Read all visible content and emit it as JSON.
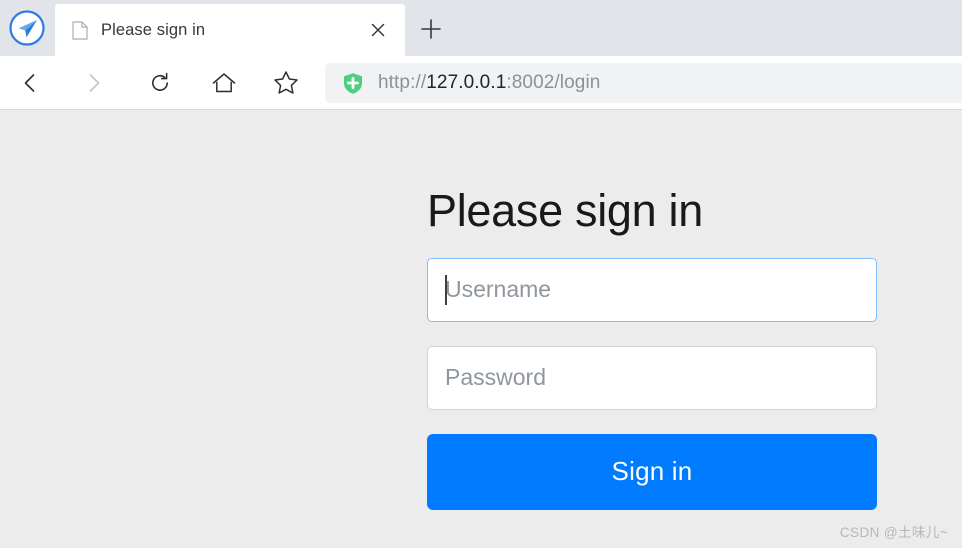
{
  "browser": {
    "logo_icon": "paper-plane-logo-icon",
    "tab": {
      "favicon": "document-page-icon",
      "title": "Please sign in",
      "close_icon": "close-icon"
    },
    "new_tab_icon": "plus-icon",
    "nav": {
      "back_icon": "chevron-left-icon",
      "forward_icon": "chevron-right-icon",
      "reload_icon": "reload-icon",
      "home_icon": "home-icon",
      "bookmark_icon": "star-icon"
    },
    "address_bar": {
      "security_icon": "green-shield-plus-icon",
      "scheme": "http://",
      "host": "127.0.0.1",
      "rest": ":8002/login"
    }
  },
  "page": {
    "heading": "Please sign in",
    "username": {
      "placeholder": "Username",
      "value": "",
      "focused": true
    },
    "password": {
      "placeholder": "Password",
      "value": "",
      "focused": false
    },
    "submit_label": "Sign in",
    "watermark": "CSDN @土味儿~"
  },
  "colors": {
    "accent": "#007bff",
    "focus_border": "#80bdff",
    "field_border": "#ced4da",
    "page_bg": "#ececec",
    "tabstrip_bg": "#e1e4e8",
    "shield_green": "#4cd080"
  }
}
